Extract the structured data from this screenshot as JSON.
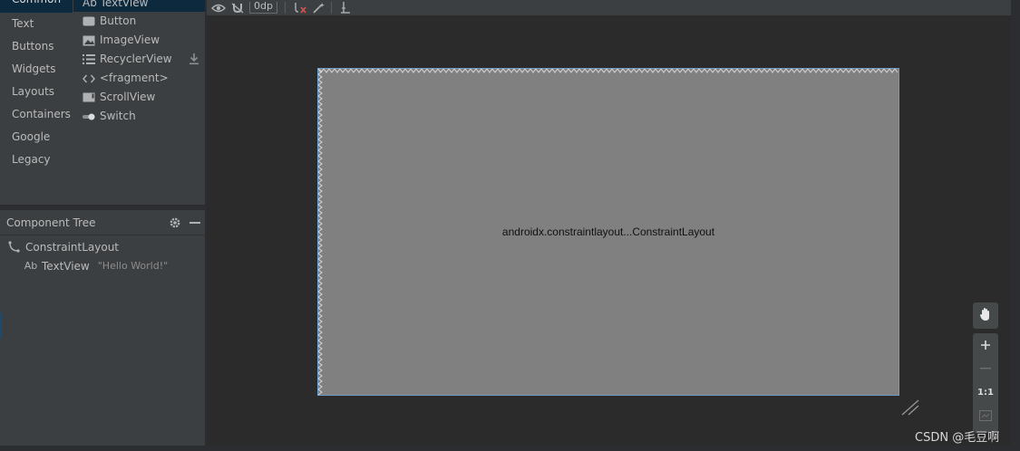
{
  "palette": {
    "categories": [
      {
        "label": "Common",
        "selected": true
      },
      {
        "label": "Text"
      },
      {
        "label": "Buttons"
      },
      {
        "label": "Widgets"
      },
      {
        "label": "Layouts"
      },
      {
        "label": "Containers"
      },
      {
        "label": "Google"
      },
      {
        "label": "Legacy"
      }
    ],
    "widgets": [
      {
        "label": "Ab TextView",
        "icon": "textview-icon",
        "selected": true
      },
      {
        "label": "Button",
        "icon": "button-icon"
      },
      {
        "label": "ImageView",
        "icon": "image-icon"
      },
      {
        "label": "RecyclerView",
        "icon": "list-icon",
        "download": true
      },
      {
        "label": "<fragment>",
        "icon": "code-brackets-icon"
      },
      {
        "label": "ScrollView",
        "icon": "scrollview-icon"
      },
      {
        "label": "Switch",
        "icon": "switch-icon"
      }
    ]
  },
  "component_tree": {
    "title": "Component Tree",
    "rows": [
      {
        "label": "ConstraintLayout",
        "icon": "constraint-layout-icon"
      },
      {
        "label": "TextView",
        "icon_text": "Ab",
        "meta": "\"Hello World!\""
      }
    ]
  },
  "toolbar": {
    "margin_value": "0dp"
  },
  "canvas": {
    "label": "androidx.constraintlayout...ConstraintLayout",
    "background": "#808080"
  },
  "zoom": {
    "actual_size_label": "1:1"
  },
  "watermark": "CSDN @毛豆啊"
}
